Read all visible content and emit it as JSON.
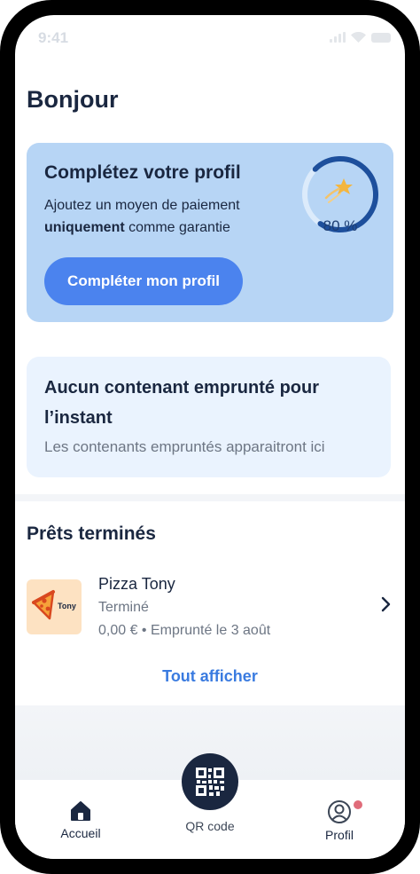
{
  "status_bar": {
    "time": "9:41"
  },
  "greeting": "Bonjour",
  "profile_card": {
    "title": "Complétez votre profil",
    "text_prefix": "Ajoutez un moyen de paiement ",
    "text_bold": "uniquement",
    "text_suffix": " comme garantie",
    "completion_percent": 80,
    "completion_label": "80 %",
    "button_label": "Compléter mon profil",
    "gauge_color": "#1d4f9c"
  },
  "empty_state": {
    "title": "Aucun contenant emprunté pour l’instant",
    "subtitle": "Les contenants empruntés apparaitront ici"
  },
  "finished_loans": {
    "title": "Prêts terminés",
    "items": [
      {
        "name": "Pizza Tony",
        "status": "Terminé",
        "detail": "0,00 € • Emprunté le 3 août",
        "thumb_text": "Tony",
        "icon": "pizza-logo"
      }
    ],
    "show_all_label": "Tout afficher"
  },
  "tabbar": {
    "home_label": "Accueil",
    "qr_label": "QR code",
    "profile_label": "Profil"
  },
  "colors": {
    "accent": "#4b83ee",
    "dark": "#1a2740",
    "card_blue": "#b7d5f5",
    "card_light": "#eaf3fe",
    "link": "#3a7be0",
    "notification": "#e06c7a"
  }
}
